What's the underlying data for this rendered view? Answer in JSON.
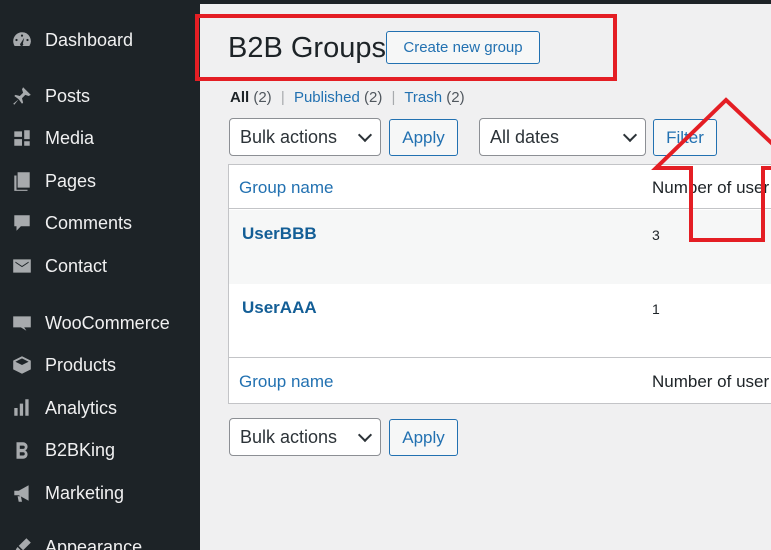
{
  "sidebar": {
    "items": [
      {
        "label": "Dashboard",
        "icon": "dashboard-icon"
      },
      {
        "label": "Posts",
        "icon": "pin-icon"
      },
      {
        "label": "Media",
        "icon": "media-icon"
      },
      {
        "label": "Pages",
        "icon": "pages-icon"
      },
      {
        "label": "Comments",
        "icon": "comment-icon"
      },
      {
        "label": "Contact",
        "icon": "mail-icon"
      },
      {
        "label": "WooCommerce",
        "icon": "woo-icon"
      },
      {
        "label": "Products",
        "icon": "box-icon"
      },
      {
        "label": "Analytics",
        "icon": "bar-chart-icon"
      },
      {
        "label": "B2BKing",
        "icon": "b2bking-icon"
      },
      {
        "label": "Marketing",
        "icon": "megaphone-icon"
      },
      {
        "label": "Appearance",
        "icon": "brush-icon"
      }
    ]
  },
  "header": {
    "title": "B2B Groups",
    "add_new_label": "Create new group"
  },
  "views": {
    "all_label": "All",
    "all_count": "(2)",
    "published_label": "Published",
    "published_count": "(2)",
    "trash_label": "Trash",
    "trash_count": "(2)"
  },
  "filters": {
    "bulk_actions": "Bulk actions",
    "apply_label": "Apply",
    "dates": "All dates",
    "filter_label": "Filter"
  },
  "table": {
    "columns": [
      "Group name",
      "Number of user"
    ],
    "rows": [
      {
        "title": "UserBBB",
        "count": "3"
      },
      {
        "title": "UserAAA",
        "count": "1"
      }
    ]
  },
  "colors": {
    "sidebar_bg": "#1d2327",
    "link": "#2271b1",
    "annotation_red": "#e41e24"
  }
}
